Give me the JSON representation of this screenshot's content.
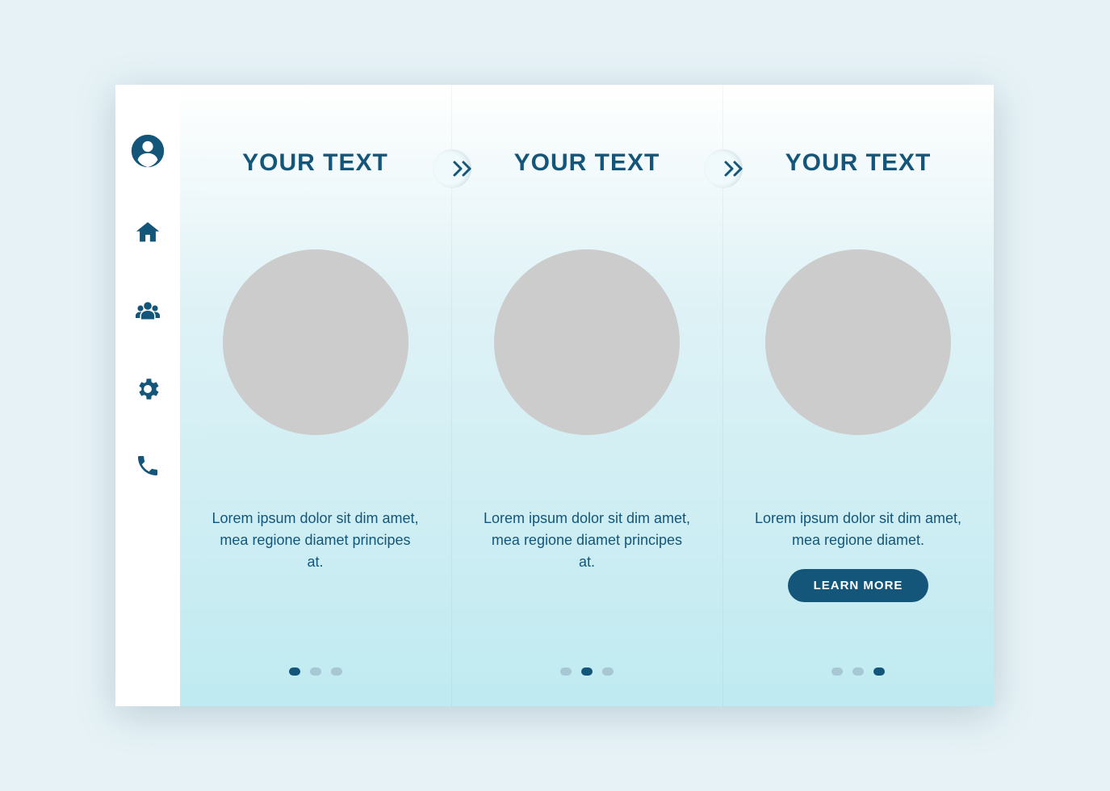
{
  "colors": {
    "brand": "#14557a",
    "bg": "#e6f2f6"
  },
  "sidebar": {
    "items": [
      {
        "name": "user",
        "icon": "user-icon"
      },
      {
        "name": "home",
        "icon": "home-icon"
      },
      {
        "name": "group",
        "icon": "group-icon"
      },
      {
        "name": "gear",
        "icon": "gear-icon"
      },
      {
        "name": "phone",
        "icon": "phone-icon"
      }
    ]
  },
  "panels": [
    {
      "title": "YOUR TEXT",
      "body": "Lorem ipsum dolor sit dim amet, mea regione diamet principes at.",
      "activeDot": 0,
      "hasCTA": false
    },
    {
      "title": "YOUR TEXT",
      "body": "Lorem ipsum dolor sit dim amet, mea regione diamet principes at.",
      "activeDot": 1,
      "hasCTA": false
    },
    {
      "title": "YOUR TEXT",
      "body": "Lorem ipsum dolor sit dim amet, mea regione diamet.",
      "activeDot": 2,
      "hasCTA": true,
      "cta": "LEARN MORE"
    }
  ]
}
